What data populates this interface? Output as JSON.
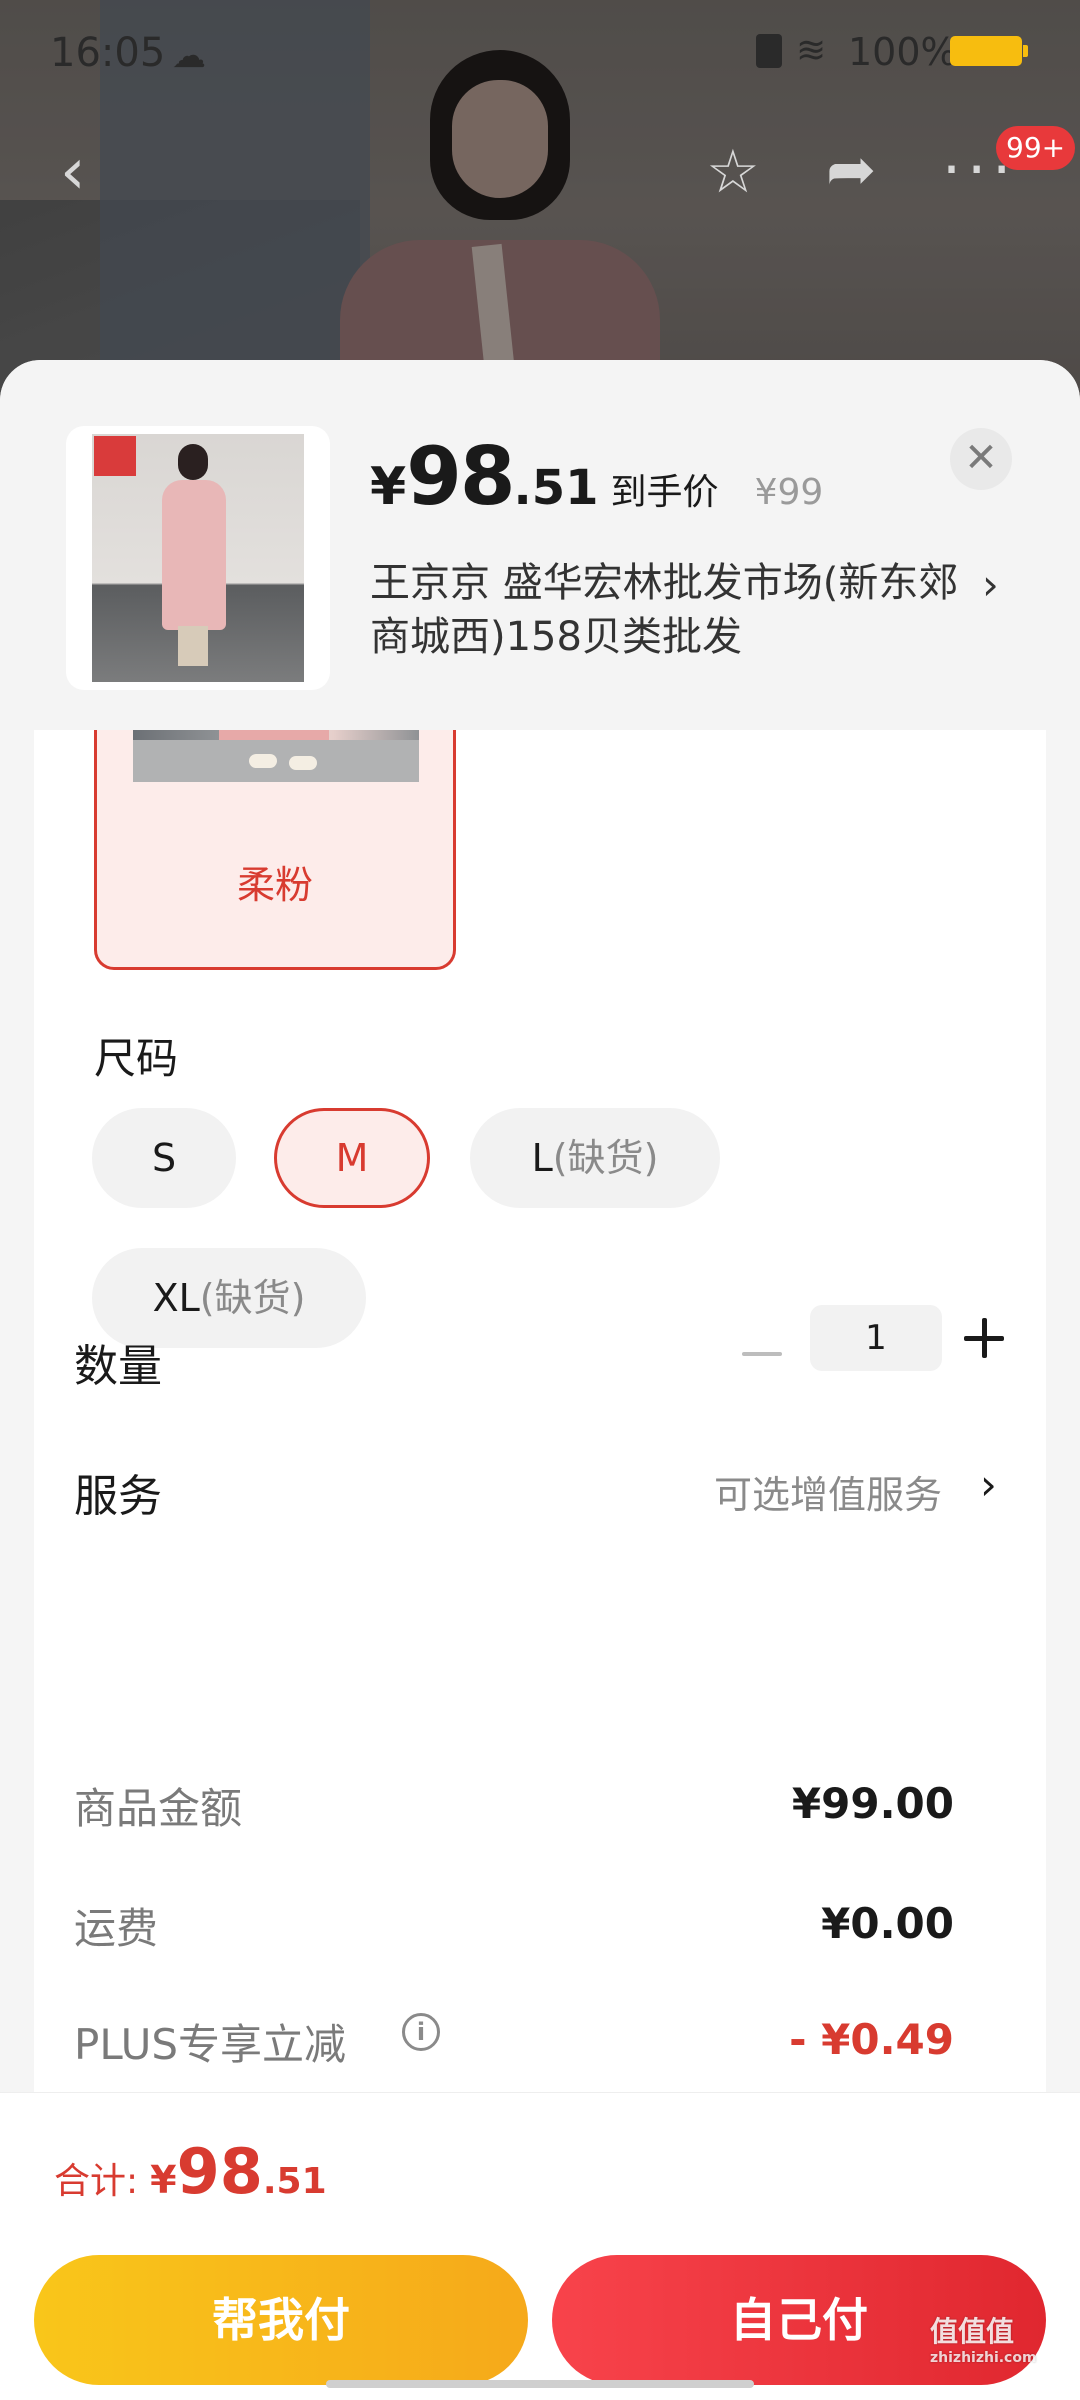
{
  "status_bar": {
    "time": "16:05",
    "battery": "100%"
  },
  "nav": {
    "badge": "99+"
  },
  "product": {
    "price_currency": "¥",
    "price_int": "98",
    "price_dec": ".51",
    "price_label": "到手价",
    "original_price": "¥99",
    "store": "王京京  盛华宏林批发市场(新东郊商城西)158贝类批发",
    "close": "✕"
  },
  "color": {
    "selected_label": "柔粉"
  },
  "size": {
    "title": "尺码",
    "options": [
      {
        "main": "S",
        "note": ""
      },
      {
        "main": "M",
        "note": ""
      },
      {
        "main": "L",
        "note": "(缺货)"
      },
      {
        "main": "XL",
        "note": "(缺货)"
      }
    ]
  },
  "quantity": {
    "label": "数量",
    "value": "1"
  },
  "service": {
    "label": "服务",
    "value": "可选增值服务"
  },
  "fees": [
    {
      "label": "商品金额",
      "value": "¥99.00"
    },
    {
      "label": "运费",
      "value": "¥0.00"
    },
    {
      "label": "PLUS专享立减",
      "value": "- ¥0.49"
    }
  ],
  "total": {
    "label": "合计:",
    "currency": "¥",
    "int": "98",
    "dec": ".51"
  },
  "buttons": {
    "help_pay": "帮我付",
    "self_pay": "自己付"
  },
  "watermark": {
    "main": "值值值",
    "sub": "zhizhizhi.com"
  },
  "colors": {
    "accent_red": "#d83b30",
    "button_yellow": "#f7b81a",
    "button_red": "#ee3139"
  }
}
